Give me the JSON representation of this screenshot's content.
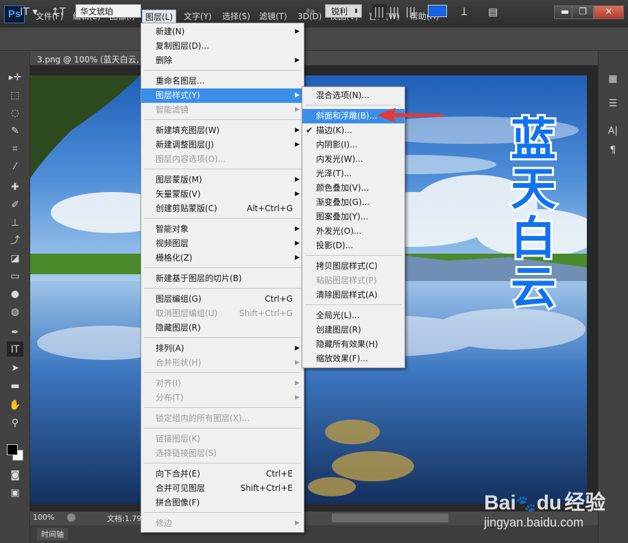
{
  "app": {
    "logo": "Ps"
  },
  "menubar": {
    "items": [
      {
        "label": "文件(F)"
      },
      {
        "label": "编辑(E)"
      },
      {
        "label": "图像(I)"
      },
      {
        "label": "图层(L)"
      },
      {
        "label": "文字(Y)"
      },
      {
        "label": "选择(S)"
      },
      {
        "label": "滤镜(T)"
      },
      {
        "label": "3D(D)"
      },
      {
        "label": "视图(V)"
      },
      {
        "label": "窗口(W)"
      },
      {
        "label": "帮助(H)"
      }
    ],
    "window_buttons": {
      "minimize": "▬",
      "restore": "❐",
      "close": "✕"
    }
  },
  "options": {
    "font_family": "华文琥珀",
    "antialias": "锐利",
    "aa_label": "ªa",
    "text_color": "#1563e6"
  },
  "document": {
    "tab_title": "3.png @ 100% (蓝天白云, R",
    "zoom": "100%",
    "doc_info": "文档:1.79",
    "timeline": "时间轴",
    "vertical_text": [
      "蓝",
      "天",
      "白",
      "云"
    ],
    "text_color": "#1172ef"
  },
  "layer_menu": {
    "items": [
      {
        "label": "新建(N)",
        "shortcut": "",
        "submenu": true,
        "disabled": false
      },
      {
        "label": "复制图层(D)...",
        "shortcut": "",
        "submenu": false,
        "disabled": false
      },
      {
        "label": "删除",
        "shortcut": "",
        "submenu": true,
        "disabled": false
      },
      {
        "label": "重命名图层...",
        "shortcut": "",
        "submenu": false,
        "disabled": false
      },
      {
        "label": "图层样式(Y)",
        "shortcut": "",
        "submenu": true,
        "disabled": false
      },
      {
        "label": "智能滤镜",
        "shortcut": "",
        "submenu": true,
        "disabled": true
      },
      {
        "label": "新建填充图层(W)",
        "shortcut": "",
        "submenu": true,
        "disabled": false
      },
      {
        "label": "新建调整图层(J)",
        "shortcut": "",
        "submenu": true,
        "disabled": false
      },
      {
        "label": "图层内容选项(O)...",
        "shortcut": "",
        "submenu": false,
        "disabled": true
      },
      {
        "label": "图层蒙版(M)",
        "shortcut": "",
        "submenu": true,
        "disabled": false
      },
      {
        "label": "矢量蒙版(V)",
        "shortcut": "",
        "submenu": true,
        "disabled": false
      },
      {
        "label": "创建剪贴蒙版(C)",
        "shortcut": "Alt+Ctrl+G",
        "submenu": false,
        "disabled": false
      },
      {
        "label": "智能对象",
        "shortcut": "",
        "submenu": true,
        "disabled": false
      },
      {
        "label": "视频图层",
        "shortcut": "",
        "submenu": true,
        "disabled": false
      },
      {
        "label": "栅格化(Z)",
        "shortcut": "",
        "submenu": true,
        "disabled": false
      },
      {
        "label": "新建基于图层的切片(B)",
        "shortcut": "",
        "submenu": false,
        "disabled": false
      },
      {
        "label": "图层编组(G)",
        "shortcut": "Ctrl+G",
        "submenu": false,
        "disabled": false
      },
      {
        "label": "取消图层编组(U)",
        "shortcut": "Shift+Ctrl+G",
        "submenu": false,
        "disabled": true
      },
      {
        "label": "隐藏图层(R)",
        "shortcut": "",
        "submenu": false,
        "disabled": false
      },
      {
        "label": "排列(A)",
        "shortcut": "",
        "submenu": true,
        "disabled": false
      },
      {
        "label": "合并形状(H)",
        "shortcut": "",
        "submenu": true,
        "disabled": true
      },
      {
        "label": "对齐(I)",
        "shortcut": "",
        "submenu": true,
        "disabled": true
      },
      {
        "label": "分布(T)",
        "shortcut": "",
        "submenu": true,
        "disabled": true
      },
      {
        "label": "锁定组内的所有图层(X)...",
        "shortcut": "",
        "submenu": false,
        "disabled": true
      },
      {
        "label": "链接图层(K)",
        "shortcut": "",
        "submenu": false,
        "disabled": true
      },
      {
        "label": "选择链接图层(S)",
        "shortcut": "",
        "submenu": false,
        "disabled": true
      },
      {
        "label": "向下合并(E)",
        "shortcut": "Ctrl+E",
        "submenu": false,
        "disabled": false
      },
      {
        "label": "合并可见图层",
        "shortcut": "Shift+Ctrl+E",
        "submenu": false,
        "disabled": false
      },
      {
        "label": "拼合图像(F)",
        "shortcut": "",
        "submenu": false,
        "disabled": false
      },
      {
        "label": "修边",
        "shortcut": "",
        "submenu": true,
        "disabled": true
      }
    ]
  },
  "style_menu": {
    "items": [
      {
        "label": "混合选项(N)...",
        "disabled": false,
        "checked": false
      },
      {
        "label": "斜面和浮雕(B)...",
        "disabled": false,
        "checked": false
      },
      {
        "label": "描边(K)...",
        "disabled": false,
        "checked": true
      },
      {
        "label": "内阴影(I)...",
        "disabled": false,
        "checked": false
      },
      {
        "label": "内发光(W)...",
        "disabled": false,
        "checked": false
      },
      {
        "label": "光泽(T)...",
        "disabled": false,
        "checked": false
      },
      {
        "label": "颜色叠加(V)...",
        "disabled": false,
        "checked": false
      },
      {
        "label": "渐变叠加(G)...",
        "disabled": false,
        "checked": false
      },
      {
        "label": "图案叠加(Y)...",
        "disabled": false,
        "checked": false
      },
      {
        "label": "外发光(O)...",
        "disabled": false,
        "checked": false
      },
      {
        "label": "投影(D)...",
        "disabled": false,
        "checked": false
      },
      {
        "label": "拷贝图层样式(C)",
        "disabled": false,
        "checked": false
      },
      {
        "label": "粘贴图层样式(P)",
        "disabled": true,
        "checked": false
      },
      {
        "label": "清除图层样式(A)",
        "disabled": false,
        "checked": false
      },
      {
        "label": "全局光(L)...",
        "disabled": false,
        "checked": false
      },
      {
        "label": "创建图层(R)",
        "disabled": false,
        "checked": false
      },
      {
        "label": "隐藏所有效果(H)",
        "disabled": false,
        "checked": false
      },
      {
        "label": "缩放效果(F)...",
        "disabled": false,
        "checked": false
      }
    ]
  },
  "watermark": {
    "brand": "Bai",
    "brand2": "du",
    "paw": "🐾",
    "text": "经验",
    "url": "jingyan.baidu.com"
  },
  "colors": {
    "highlight": "#3b8ee8",
    "arrow": "#e53935"
  }
}
